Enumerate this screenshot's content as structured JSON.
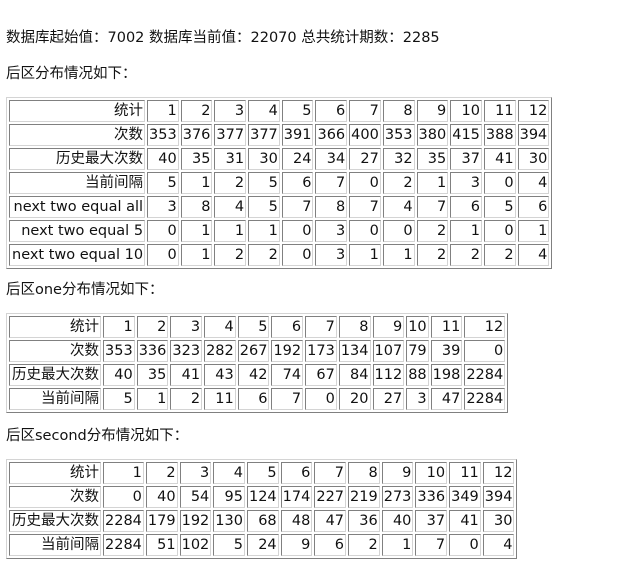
{
  "summary": {
    "text": "数据库起始值：7002 数据库当前值：22070 总共统计期数：2285",
    "db_start_value": 7002,
    "db_current_value": 22070,
    "total_periods": 2285
  },
  "sections": [
    {
      "heading": "后区分布情况如下：",
      "header_label": "统计",
      "columns": [
        "1",
        "2",
        "3",
        "4",
        "5",
        "6",
        "7",
        "8",
        "9",
        "10",
        "11",
        "12"
      ],
      "rows": [
        {
          "label": "次数",
          "values": [
            353,
            376,
            377,
            377,
            391,
            366,
            400,
            353,
            380,
            415,
            388,
            394
          ]
        },
        {
          "label": "历史最大次数",
          "values": [
            40,
            35,
            31,
            30,
            24,
            34,
            27,
            32,
            35,
            37,
            41,
            30
          ]
        },
        {
          "label": "当前间隔",
          "values": [
            5,
            1,
            2,
            5,
            6,
            7,
            0,
            2,
            1,
            3,
            0,
            4
          ]
        },
        {
          "label": "next two equal all",
          "values": [
            3,
            8,
            4,
            5,
            7,
            8,
            7,
            4,
            7,
            6,
            5,
            6
          ]
        },
        {
          "label": "next two equal 5",
          "values": [
            0,
            1,
            1,
            1,
            0,
            3,
            0,
            0,
            2,
            1,
            0,
            1
          ]
        },
        {
          "label": "next two equal 10",
          "values": [
            0,
            1,
            2,
            2,
            0,
            3,
            1,
            1,
            2,
            2,
            2,
            4
          ]
        }
      ]
    },
    {
      "heading": "后区one分布情况如下：",
      "header_label": "统计",
      "columns": [
        "1",
        "2",
        "3",
        "4",
        "5",
        "6",
        "7",
        "8",
        "9",
        "10",
        "11",
        "12"
      ],
      "rows": [
        {
          "label": "次数",
          "values": [
            353,
            336,
            323,
            282,
            267,
            192,
            173,
            134,
            107,
            79,
            39,
            0
          ]
        },
        {
          "label": "历史最大次数",
          "values": [
            40,
            35,
            41,
            43,
            42,
            74,
            67,
            84,
            112,
            88,
            198,
            2284
          ]
        },
        {
          "label": "当前间隔",
          "values": [
            5,
            1,
            2,
            11,
            6,
            7,
            0,
            20,
            27,
            3,
            47,
            2284
          ]
        }
      ]
    },
    {
      "heading": "后区second分布情况如下：",
      "header_label": "统计",
      "columns": [
        "1",
        "2",
        "3",
        "4",
        "5",
        "6",
        "7",
        "8",
        "9",
        "10",
        "11",
        "12"
      ],
      "rows": [
        {
          "label": "次数",
          "values": [
            0,
            40,
            54,
            95,
            124,
            174,
            227,
            219,
            273,
            336,
            349,
            394
          ]
        },
        {
          "label": "历史最大次数",
          "values": [
            2284,
            179,
            192,
            130,
            68,
            48,
            47,
            36,
            40,
            37,
            41,
            30
          ]
        },
        {
          "label": "当前间隔",
          "values": [
            2284,
            51,
            102,
            5,
            24,
            9,
            6,
            2,
            1,
            7,
            0,
            4
          ]
        }
      ]
    }
  ]
}
